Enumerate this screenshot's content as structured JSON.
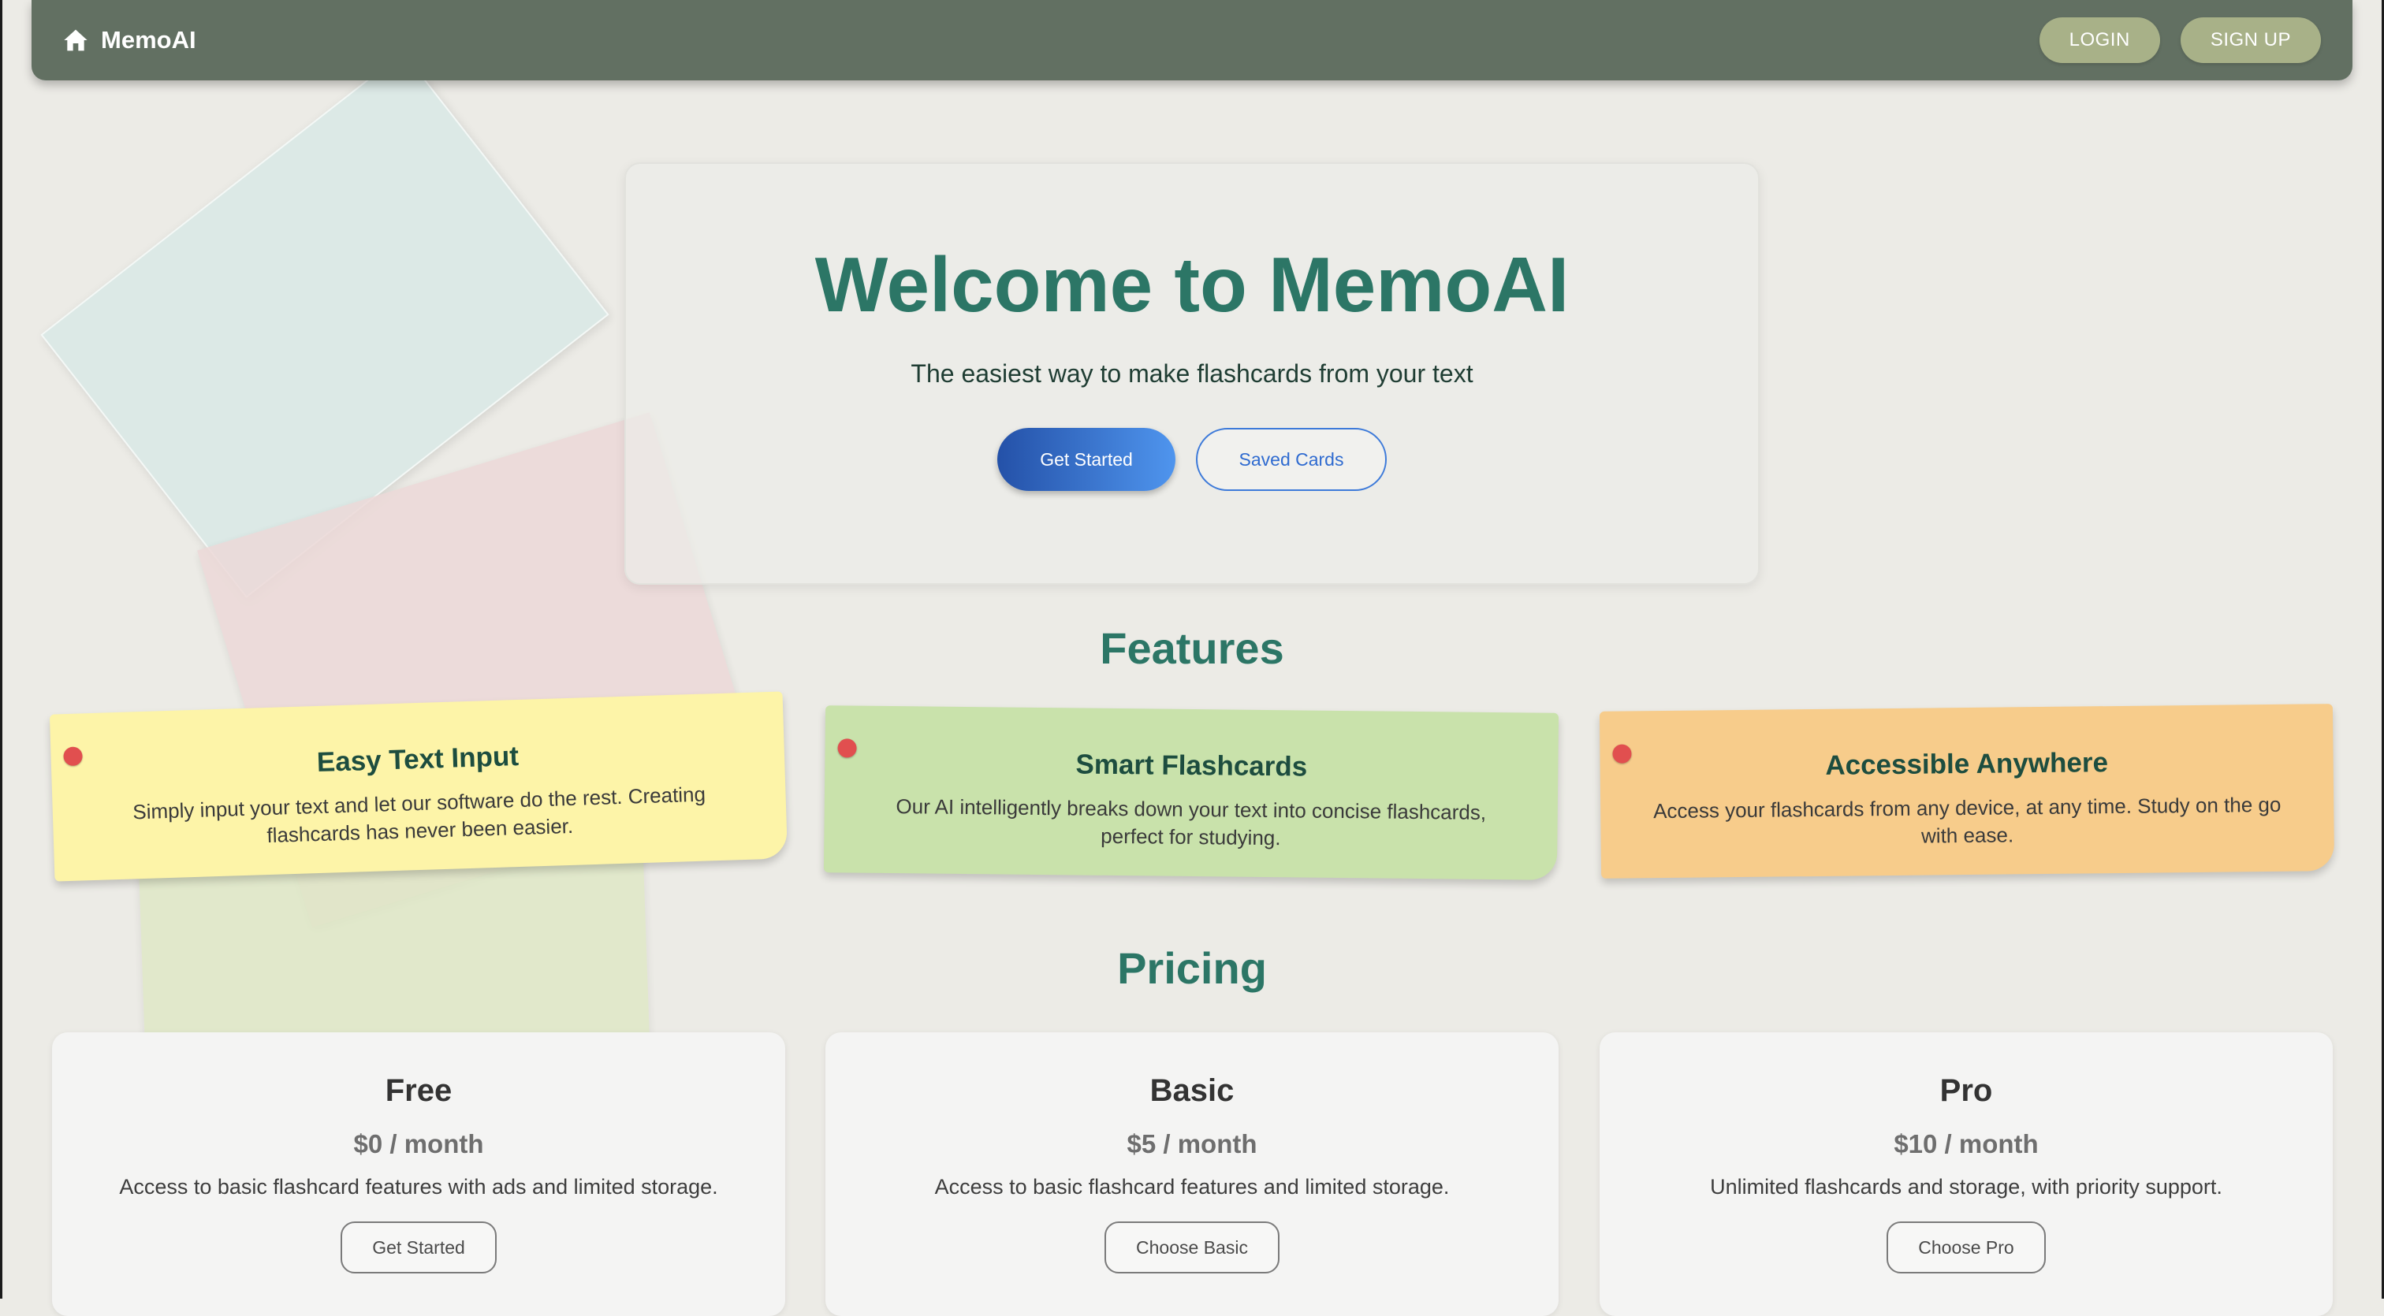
{
  "header": {
    "brand": "MemoAI",
    "login_label": "LOGIN",
    "signup_label": "SIGN UP"
  },
  "hero": {
    "title": "Welcome to MemoAI",
    "subtitle": "The easiest way to make flashcards from your text",
    "primary_button": "Get Started",
    "secondary_button": "Saved Cards"
  },
  "features": {
    "heading": "Features",
    "items": [
      {
        "title": "Easy Text Input",
        "text": "Simply input your text and let our software do the rest. Creating flashcards has never been easier.",
        "color": "#fdf4a8"
      },
      {
        "title": "Smart Flashcards",
        "text": "Our AI intelligently breaks down your text into concise flashcards, perfect for studying.",
        "color": "#c9e2ab"
      },
      {
        "title": "Accessible Anywhere",
        "text": "Access your flashcards from any device, at any time. Study on the go with ease.",
        "color": "#f7cc8b"
      }
    ]
  },
  "pricing": {
    "heading": "Pricing",
    "plans": [
      {
        "name": "Free",
        "price": "$0 / month",
        "description": "Access to basic flashcard features with ads and limited storage.",
        "button": "Get Started"
      },
      {
        "name": "Basic",
        "price": "$5 / month",
        "description": "Access to basic flashcard features and limited storage.",
        "button": "Choose Basic"
      },
      {
        "name": "Pro",
        "price": "$10 / month",
        "description": "Unlimited flashcards and storage, with priority support.",
        "button": "Choose Pro"
      }
    ]
  },
  "colors": {
    "navbar": "#627062",
    "accent": "#2c7666",
    "nav_button": "#a8b188",
    "primary_button": "#2451a8"
  }
}
